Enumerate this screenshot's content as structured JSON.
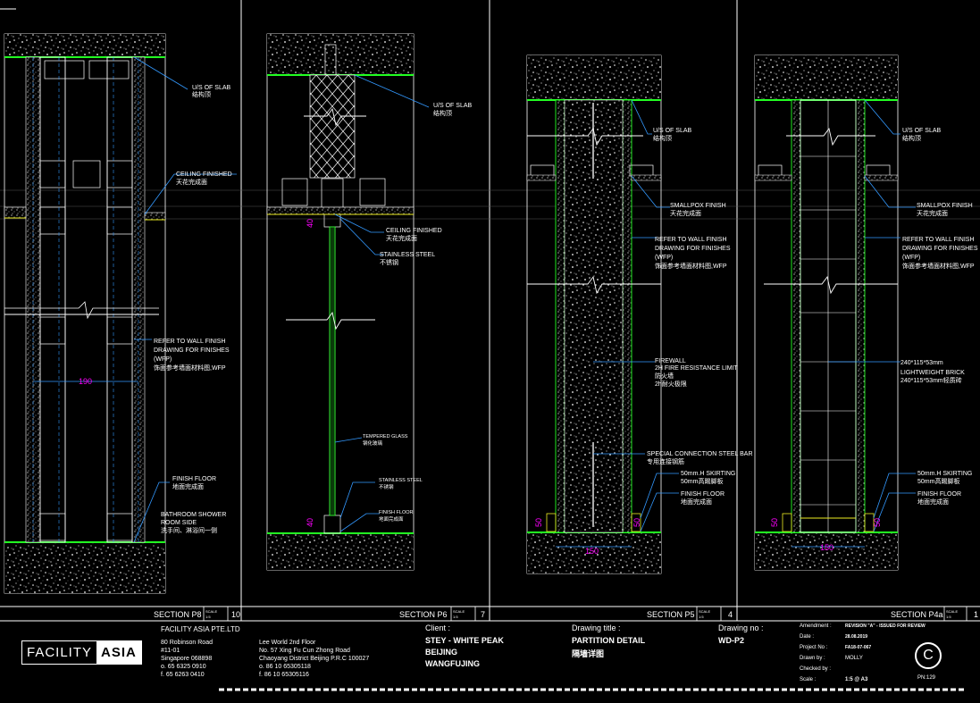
{
  "sections": [
    {
      "title": "SECTION P8",
      "scale_label": "SCALE",
      "scale": "1:5",
      "number": "10",
      "labels": {
        "slab": "U/S OF SLAB",
        "slab_cn": "结构顶",
        "ceiling": "CEILING FINISHED",
        "ceiling_cn": "天花完成面",
        "refer1": "REFER TO WALL FINISH",
        "refer2": "DRAWING FOR FINISHES",
        "refer3": "(WFP)",
        "refer_cn": "饰面参考墙面材料图,WFP",
        "floor": "FINISH FLOOR",
        "floor_cn": "地面完成面",
        "bath1": "BATHROOM SHOWER",
        "bath2": "ROOM SIDE",
        "bath_cn": "洗手间、淋浴间一侧"
      },
      "dims": {
        "width": "190"
      }
    },
    {
      "title": "SECTION P6",
      "scale_label": "SCALE",
      "scale": "1:5",
      "number": "7",
      "labels": {
        "slab": "U/S OF SLAB",
        "slab_cn": "结构顶",
        "ceiling": "CEILING FINISHED",
        "ceiling_cn": "天花完成面",
        "steel": "STAINLESS STEEL",
        "steel_cn": "不锈钢",
        "glass": "TEMPERED GLASS",
        "glass_cn": "钢化玻璃",
        "steel2": "STAINLESS STEEL",
        "steel2_cn": "不锈钢",
        "floor": "FINISH FLOOR",
        "floor_cn": "地面完成面"
      },
      "dims": {
        "top": "40",
        "bottom": "40"
      }
    },
    {
      "title": "SECTION P5",
      "scale_label": "SCALE",
      "scale": "1:5",
      "number": "4",
      "labels": {
        "slab": "U/S OF SLAB",
        "slab_cn": "结构顶",
        "smallpox": "SMALLPOX FINISH",
        "smallpox_cn": "天花完成面",
        "refer1": "REFER TO WALL FINISH",
        "refer2": "DRAWING FOR FINISHES",
        "refer3": "(WFP)",
        "refer_cn": "饰面参考墙面材料图,WFP",
        "fire1": "FIREWALL",
        "fire2": "2H FIRE RESISTANCE LIMIT",
        "fire_cn1": "防火墙",
        "fire_cn2": "2h耐火极限",
        "bar": "SPECIAL CONNECTION STEEL BAR",
        "bar_cn": "专用连接钢筋",
        "skirt": "50mm.H SKIRTING",
        "skirt_cn": "50mm高踢脚板",
        "floor": "FINISH FLOOR",
        "floor_cn": "地面完成面"
      },
      "dims": {
        "width": "150",
        "left": "50",
        "right": "50"
      }
    },
    {
      "title": "SECTION P4a",
      "scale_label": "SCALE",
      "scale": "1:5",
      "number": "1",
      "labels": {
        "slab": "U/S OF SLAB",
        "slab_cn": "结构顶",
        "smallpox": "SMALLPOX FINISH",
        "smallpox_cn": "天花完成面",
        "refer1": "REFER TO WALL FINISH",
        "refer2": "DRAWING FOR FINISHES",
        "refer3": "(WFP)",
        "refer_cn": "饰面参考墙面材料图,WFP",
        "brick1": "240*115*53mm",
        "brick2": "LIGHTWEIGHT BRICK",
        "brick3": "240*115*53mm轻质砖",
        "skirt": "50mm.H SKIRTING",
        "skirt_cn": "50mm高踢脚板",
        "floor": "FINISH FLOOR",
        "floor_cn": "地面完成面"
      },
      "dims": {
        "width": "150",
        "left": "50",
        "right": "50"
      }
    }
  ],
  "title_block": {
    "logo_left": "FACILITY",
    "logo_right": "ASIA",
    "company": "FACILITY ASIA PTE.LTD",
    "sg_address": [
      "80 Robinson Road",
      "#11-01",
      "Singapore 068898",
      "o. 65 6325 0910",
      "f. 65 6263 0410"
    ],
    "bj_address": [
      "Lee World 2nd Floor",
      "No. 57 Xing Fu Cun Zhong Road",
      "Chaoyang District Beijing P.R.C 100027",
      "o. 86 10 65305118",
      "f. 86 10 65305116"
    ],
    "client_label": "Client :",
    "client": [
      "STEY - WHITE PEAK",
      "BEIJING",
      "WANGFUJING"
    ],
    "drawing_title_label": "Drawing title :",
    "drawing_title": "PARTITION DETAIL",
    "drawing_title_cn": "隔墙详图",
    "drawing_no_label": "Drawing no :",
    "drawing_no": "WD-P2",
    "amendment_label": "Amendment :",
    "amendment": "REVISION \"A\" - ISSUED FOR REVIEW",
    "date_label": "Date :",
    "date": "28.08.2019",
    "project_label": "Project No :",
    "project": "FA18-07-067",
    "drawn_label": "Drawn by :",
    "drawn": "MOLLY",
    "checked_label": "Checked by :",
    "checked": "",
    "scale_label": "Scale :",
    "scale": "1:5 @ A3",
    "copyright": "C",
    "page_no": "PN:129"
  }
}
